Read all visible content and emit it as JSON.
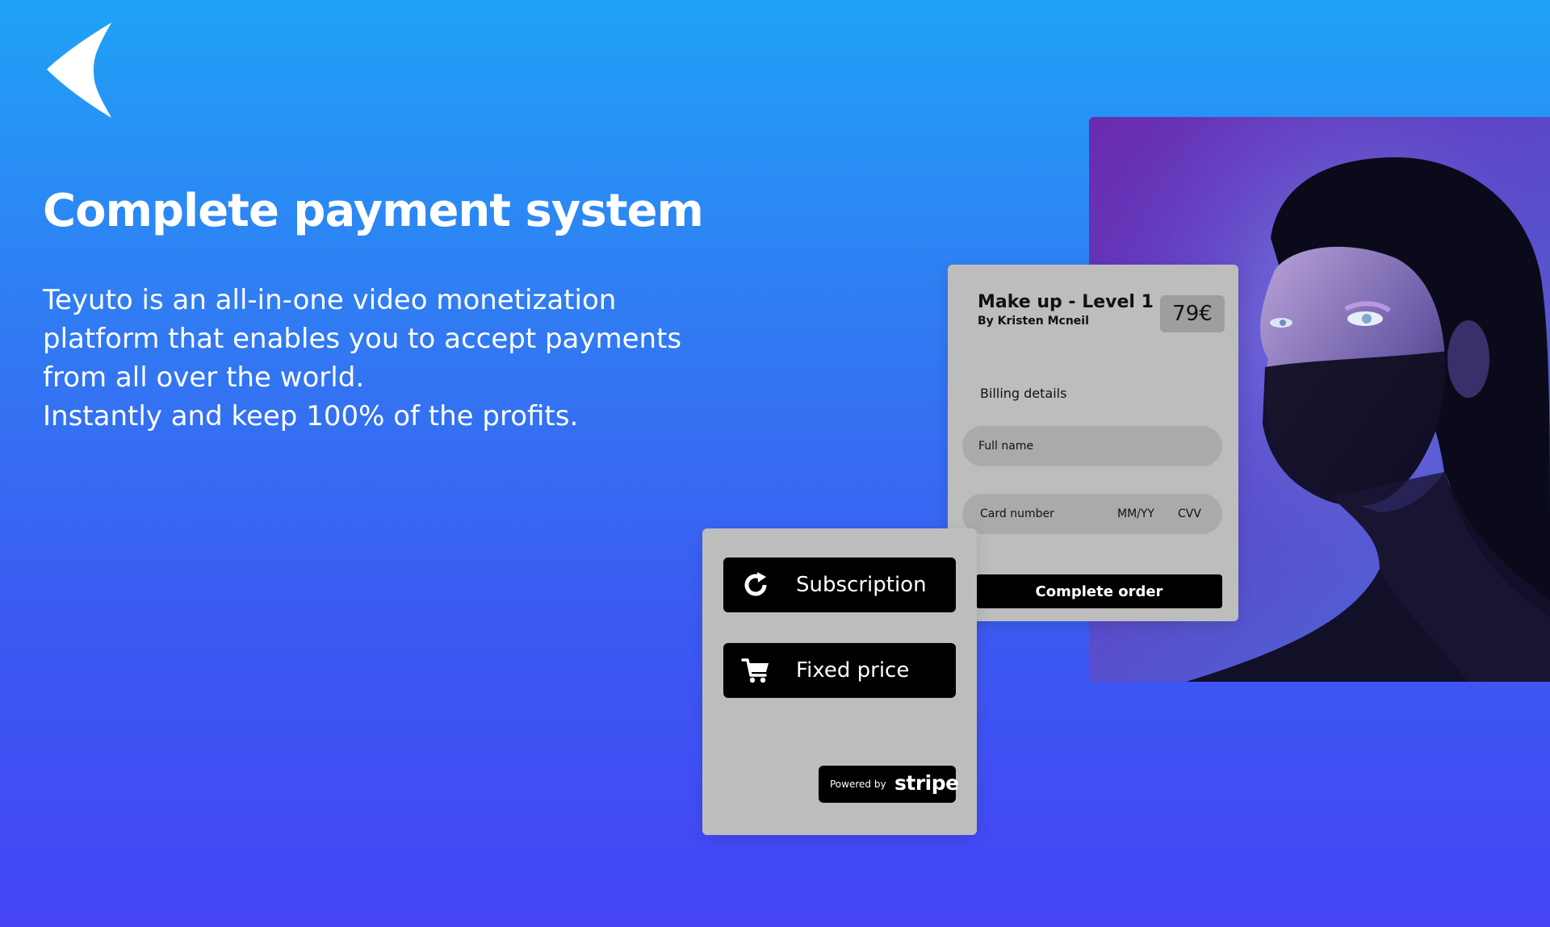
{
  "hero": {
    "logo_icon": "arrowhead-logo-icon",
    "title": "Complete payment system",
    "description_lines": [
      "Teyuto is an all-in-one video monetization",
      "platform that enables you to accept payments",
      "from all over the world.",
      "Instantly and keep 100% of the profits."
    ]
  },
  "checkout": {
    "course_title": "Make up - Level 1",
    "course_author": "By Kristen Mcneil",
    "price": "79€",
    "billing_label": "Billing details",
    "full_name_placeholder": "Full name",
    "card_number_placeholder": "Card number",
    "expiry_placeholder": "MM/YY",
    "cvv_placeholder": "CVV",
    "complete_label": "Complete order"
  },
  "pricing": {
    "subscription_label": "Subscription",
    "subscription_icon": "refresh-icon",
    "fixed_price_label": "Fixed price",
    "fixed_price_icon": "cart-icon",
    "stripe_powered": "Powered by",
    "stripe_brand": "stripe"
  },
  "colors": {
    "background_top": "#1fa2f7",
    "background_bottom": "#4444f5",
    "card": "#bdbdbd",
    "field": "#aaaaaa",
    "button": "#000000"
  }
}
